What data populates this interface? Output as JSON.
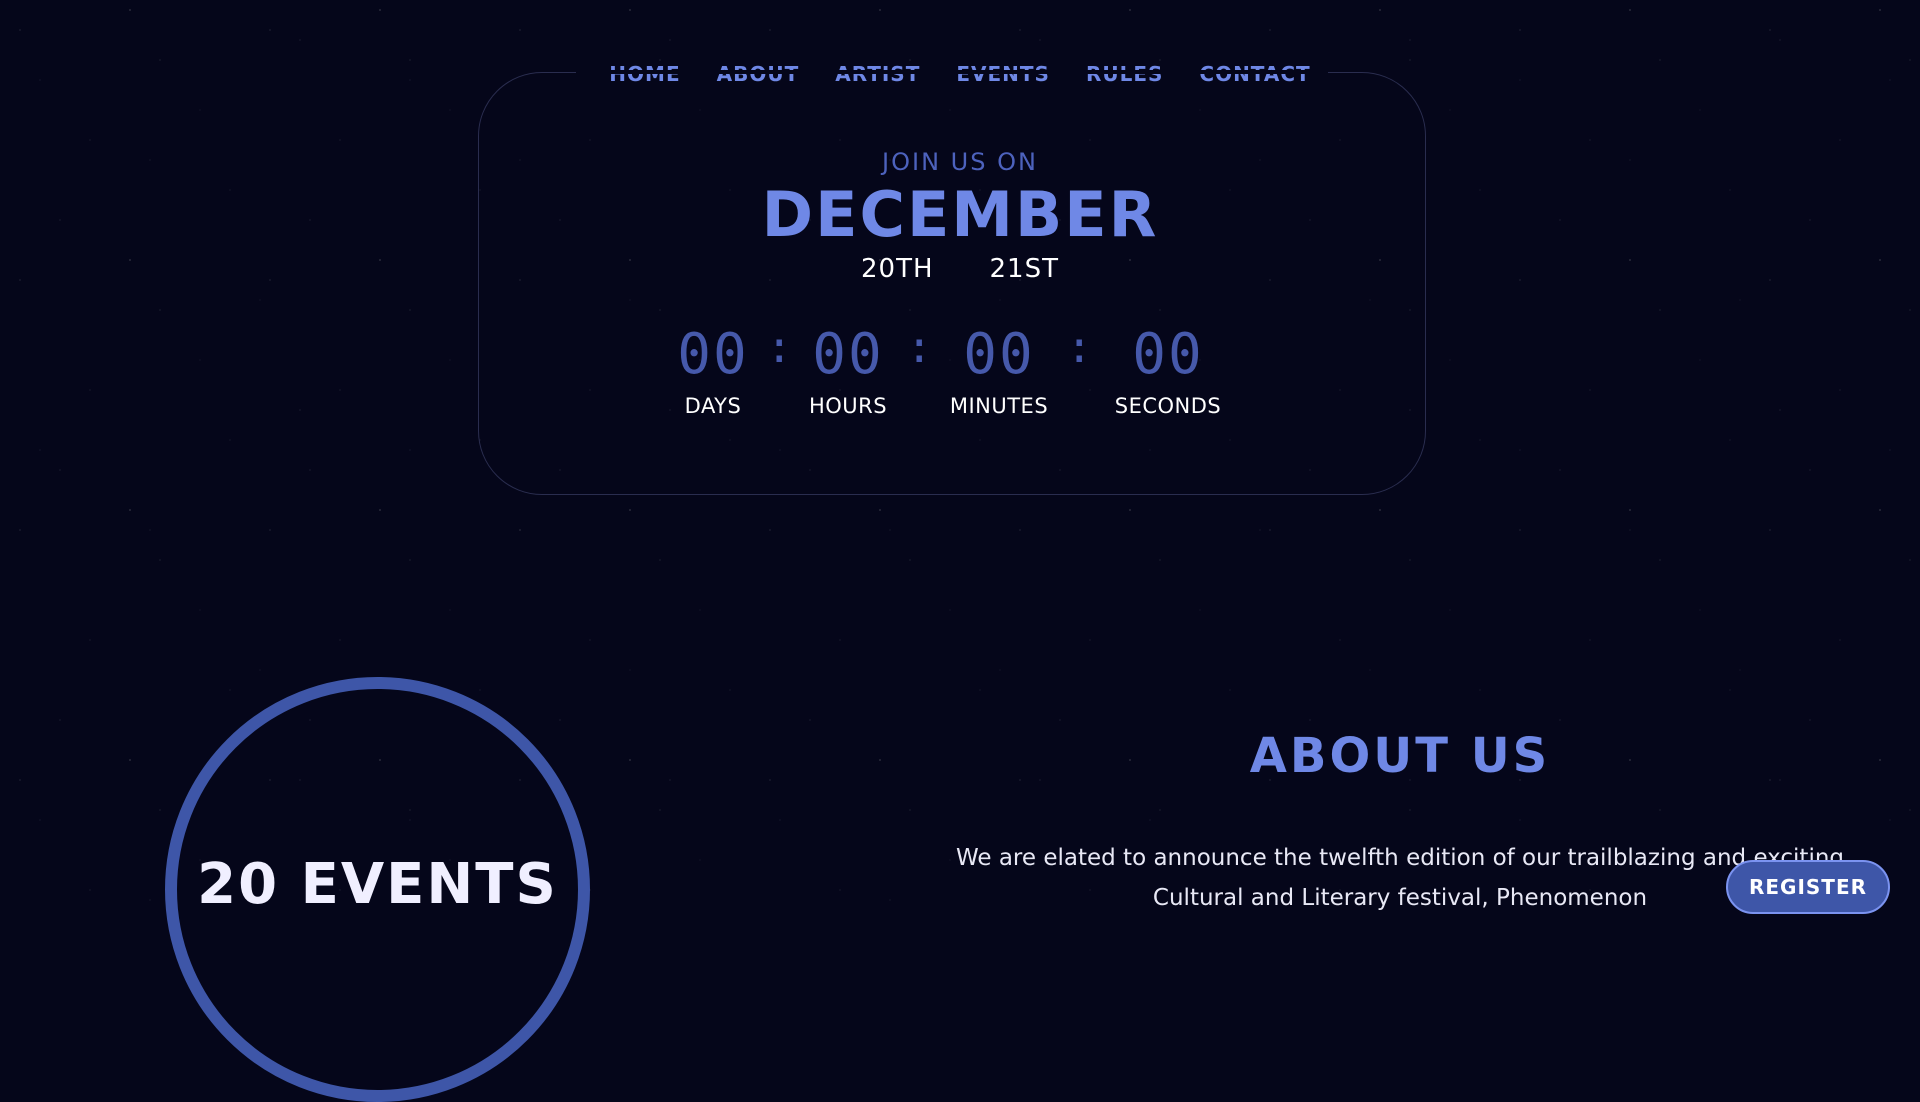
{
  "nav": {
    "items": [
      {
        "label": "HOME"
      },
      {
        "label": "ABOUT"
      },
      {
        "label": "ARTIST"
      },
      {
        "label": "EVENTS"
      },
      {
        "label": "RULES"
      },
      {
        "label": "CONTACT"
      }
    ]
  },
  "hero": {
    "join_text": "JOIN US ON",
    "month": "DECEMBER",
    "dates": [
      "20TH",
      "21ST"
    ]
  },
  "countdown": {
    "units": [
      {
        "value": "00",
        "label": "DAYS"
      },
      {
        "value": "00",
        "label": "HOURS"
      },
      {
        "value": "00",
        "label": "MINUTES"
      },
      {
        "value": "00",
        "label": "SECONDS"
      }
    ],
    "separator": ":"
  },
  "events_badge": {
    "text": "20 EVENTS"
  },
  "about": {
    "title": "ABOUT US",
    "paragraph_line1": "We are elated to announce the twelfth edition of our trailblazing and exciting",
    "paragraph_line2": "Cultural and Literary festival, Phenomenon"
  },
  "register": {
    "label": "REGISTER"
  },
  "colors": {
    "background": "#05061a",
    "accent": "#6f88e6",
    "accent_dark": "#3e56a8"
  }
}
